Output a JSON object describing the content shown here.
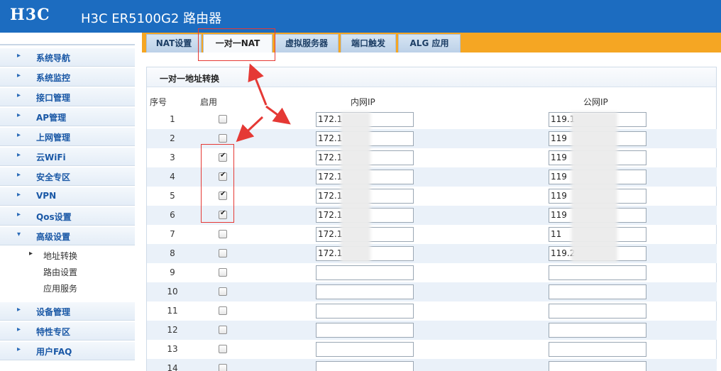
{
  "header": {
    "logo": "H3C",
    "title": "H3C ER5100G2 路由器"
  },
  "sidebar": {
    "items": [
      {
        "label": "系统导航"
      },
      {
        "label": "系统监控"
      },
      {
        "label": "接口管理"
      },
      {
        "label": "AP管理"
      },
      {
        "label": "上网管理"
      },
      {
        "label": "云WiFi"
      },
      {
        "label": "安全专区"
      },
      {
        "label": "VPN"
      },
      {
        "label": "Qos设置"
      },
      {
        "label": "高级设置"
      }
    ],
    "sub_items": [
      {
        "label": "地址转换"
      },
      {
        "label": "路由设置"
      },
      {
        "label": "应用服务"
      }
    ],
    "bottom_items": [
      {
        "label": "设备管理"
      },
      {
        "label": "特性专区"
      },
      {
        "label": "用户FAQ"
      }
    ]
  },
  "tabs": [
    {
      "label": "NAT设置"
    },
    {
      "label": "一对一NAT"
    },
    {
      "label": "虚拟服务器"
    },
    {
      "label": "端口触发"
    },
    {
      "label": "ALG 应用"
    }
  ],
  "section": {
    "title": "一对一地址转换"
  },
  "table": {
    "headers": {
      "no": "序号",
      "enable": "启用",
      "lan_ip": "内网IP",
      "wan_ip": "公网IP"
    },
    "rows": [
      {
        "no": "1",
        "lan": "172.1",
        "wan": "119.1"
      },
      {
        "no": "2",
        "lan": "172.1",
        "wan": "119"
      },
      {
        "no": "3",
        "lan": "172.1",
        "wan": "119"
      },
      {
        "no": "4",
        "lan": "172.1",
        "wan": "119"
      },
      {
        "no": "5",
        "lan": "172.1",
        "wan": "119"
      },
      {
        "no": "6",
        "lan": "172.1",
        "wan": "119"
      },
      {
        "no": "7",
        "lan": "172.1",
        "wan": "11"
      },
      {
        "no": "8",
        "lan": "172.1",
        "wan": "119.2"
      },
      {
        "no": "9",
        "lan": "",
        "wan": ""
      },
      {
        "no": "10",
        "lan": "",
        "wan": ""
      },
      {
        "no": "11",
        "lan": "",
        "wan": ""
      },
      {
        "no": "12",
        "lan": "",
        "wan": ""
      },
      {
        "no": "13",
        "lan": "",
        "wan": ""
      },
      {
        "no": "14",
        "lan": "",
        "wan": ""
      }
    ]
  }
}
